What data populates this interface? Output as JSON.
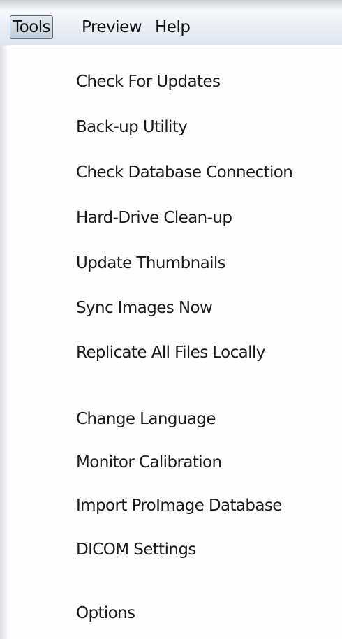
{
  "menubar": {
    "tools_label": "Tools",
    "preview_label": "Preview",
    "help_label": "Help"
  },
  "tools_menu": {
    "items": [
      {
        "label": "Check For Updates"
      },
      {
        "label": "Back-up Utility"
      },
      {
        "label": "Check Database Connection"
      },
      {
        "label": "Hard-Drive Clean-up"
      },
      {
        "label": "Update Thumbnails"
      },
      {
        "label": "Sync Images Now"
      },
      {
        "label": "Replicate All Files Locally"
      },
      {
        "label": "Change Language"
      },
      {
        "label": "Monitor Calibration"
      },
      {
        "label": "Import ProImage Database"
      },
      {
        "label": "DICOM Settings"
      },
      {
        "label": "Options"
      }
    ]
  },
  "colors": {
    "menubar_bg": "#e9eef6",
    "menu_bg": "#fdfdfd",
    "active_border": "#5a6f8c",
    "text": "#1a1a1a"
  }
}
